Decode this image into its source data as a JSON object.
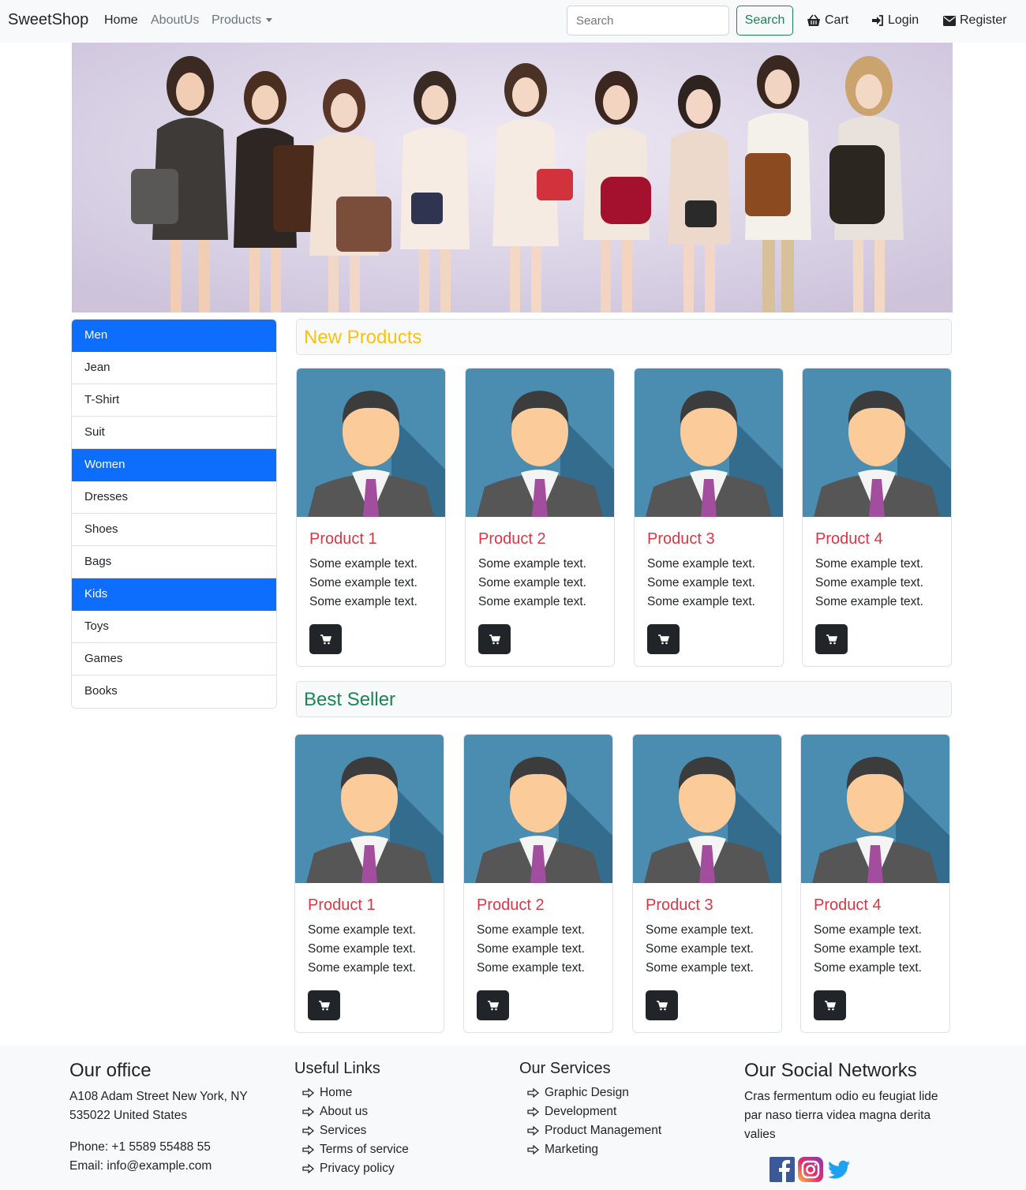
{
  "navbar": {
    "brand": "SweetShop",
    "links": {
      "home": "Home",
      "about": "AboutUs",
      "products": "Products"
    },
    "search": {
      "placeholder": "Search",
      "button": "Search"
    },
    "cart": "Cart",
    "login": "Login",
    "register": "Register"
  },
  "hero": {
    "icon": "fashion-banner-image"
  },
  "sidebar": {
    "items": [
      {
        "label": "Men",
        "active": true
      },
      {
        "label": "Jean"
      },
      {
        "label": "T-Shirt"
      },
      {
        "label": "Suit"
      },
      {
        "label": "Women",
        "active": true
      },
      {
        "label": "Dresses"
      },
      {
        "label": "Shoes"
      },
      {
        "label": "Bags"
      },
      {
        "label": "Kids",
        "active": true
      },
      {
        "label": "Toys"
      },
      {
        "label": "Games"
      },
      {
        "label": "Books"
      }
    ]
  },
  "new_products": {
    "title": "New Products",
    "cards": [
      {
        "title": "Product 1",
        "text": "Some example text. Some example text. Some example text."
      },
      {
        "title": "Product 2",
        "text": "Some example text. Some example text. Some example text."
      },
      {
        "title": "Product 3",
        "text": "Some example text. Some example text. Some example text."
      },
      {
        "title": "Product 4",
        "text": "Some example text. Some example text. Some example text."
      }
    ]
  },
  "best_seller": {
    "title": "Best Seller",
    "cards": [
      {
        "title": "Product 1",
        "text": "Some example text. Some example text. Some example text."
      },
      {
        "title": "Product 2",
        "text": "Some example text. Some example text. Some example text."
      },
      {
        "title": "Product 3",
        "text": "Some example text. Some example text. Some example text."
      },
      {
        "title": "Product 4",
        "text": "Some example text. Some example text. Some example text."
      }
    ]
  },
  "footer": {
    "office": {
      "title": "Our office",
      "address": "A108 Adam Street New York, NY 535022 United States",
      "phone": "Phone: +1 5589 55488 55",
      "email": "Email: info@example.com"
    },
    "links": {
      "title": "Useful Links",
      "items": [
        "Home",
        "About us",
        "Services",
        "Terms of service",
        "Privacy policy"
      ]
    },
    "services": {
      "title": "Our Services",
      "items": [
        "Graphic Design",
        "Development",
        "Product Management",
        "Marketing"
      ]
    },
    "social": {
      "title": "Our Social Networks",
      "text": "Cras fermentum odio eu feugiat lide par naso tierra videa magna derita valies",
      "icons": [
        "facebook-icon",
        "instagram-icon",
        "twitter-icon"
      ]
    }
  },
  "colors": {
    "primary": "#0d6efd",
    "warning": "#ffc107",
    "success": "#198754",
    "danger": "#dc3545",
    "dark": "#212529",
    "light": "#f8f9fa"
  }
}
